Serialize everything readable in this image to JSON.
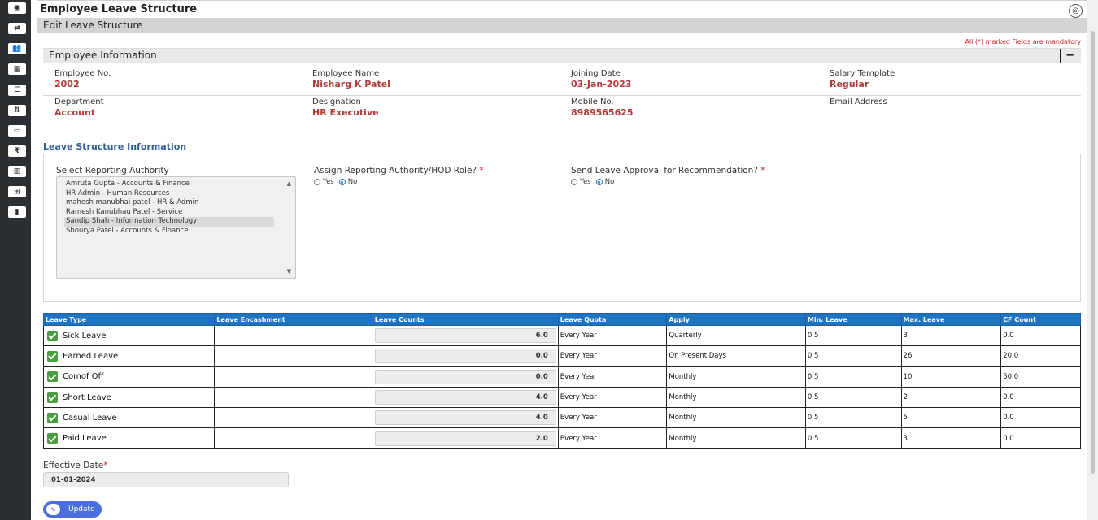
{
  "sidebar": {
    "icons": [
      {
        "name": "dashboard-icon",
        "glyph": "◉"
      },
      {
        "name": "shuffle-icon",
        "glyph": "⇄"
      },
      {
        "name": "users-icon",
        "glyph": "👥"
      },
      {
        "name": "calendar-icon",
        "glyph": "▦"
      },
      {
        "name": "list-icon",
        "glyph": "☰"
      },
      {
        "name": "sort-icon",
        "glyph": "⇅"
      },
      {
        "name": "money-icon",
        "glyph": "▭"
      },
      {
        "name": "rupee-icon",
        "glyph": "₹"
      },
      {
        "name": "chart-icon",
        "glyph": "▥"
      },
      {
        "name": "org-chart-icon",
        "glyph": "⊞"
      },
      {
        "name": "bookmark-icon",
        "glyph": "▮"
      }
    ]
  },
  "header": {
    "title": "Employee Leave Structure",
    "subtitle": "Edit Leave Structure",
    "mandatory_note": "All (*) marked Fields are mandatory"
  },
  "employee_info": {
    "title": "Employee Information",
    "collapse_label": "−",
    "rows": [
      [
        {
          "label": "Employee No.",
          "value": "2002"
        },
        {
          "label": "Employee Name",
          "value": "Nisharg K Patel"
        },
        {
          "label": "Joining Date",
          "value": "03-Jan-2023"
        },
        {
          "label": "Salary Template",
          "value": "Regular"
        }
      ],
      [
        {
          "label": "Department",
          "value": "Account"
        },
        {
          "label": "Designation",
          "value": "HR Executive"
        },
        {
          "label": "Mobile No.",
          "value": "8989565625"
        },
        {
          "label": "Email Address",
          "value": ""
        }
      ]
    ]
  },
  "leave_structure": {
    "title": "Leave Structure Information",
    "reporting_authority_label": "Select Reporting Authority",
    "reporting_authorities": [
      "Amruta Gupta - Accounts & Finance",
      "HR Admin - Human Resources",
      "mahesh manubhai patel - HR & Admin",
      "Ramesh Kanubhau Patel - Service",
      "Sandip Shah - Information Technology",
      "Shourya Patel - Accounts & Finance"
    ],
    "selected_authority_index": 4,
    "assign_hod_label": "Assign Reporting Authority/HOD Role?",
    "send_approval_label": "Send Leave Approval for Recommendation?",
    "required_mark": "*",
    "yes_label": "Yes",
    "no_label": "No",
    "assign_hod_value": "No",
    "send_approval_value": "No"
  },
  "leave_table": {
    "columns": [
      "Leave Type",
      "Leave Encashment",
      "Leave Counts",
      "Leave Quota",
      "Apply",
      "Min. Leave",
      "Max. Leave",
      "CF Count"
    ],
    "rows": [
      {
        "type": "Sick Leave",
        "encashment": "",
        "count": "6.0",
        "quota": "Every Year",
        "apply": "Quarterly",
        "min": "0.5",
        "max": "3",
        "cf": "0.0"
      },
      {
        "type": "Earned Leave",
        "encashment": "",
        "count": "0.0",
        "quota": "Every Year",
        "apply": "On Present Days",
        "min": "0.5",
        "max": "26",
        "cf": "20.0"
      },
      {
        "type": "Comof Off",
        "encashment": "",
        "count": "0.0",
        "quota": "Every Year",
        "apply": "Monthly",
        "min": "0.5",
        "max": "10",
        "cf": "50.0"
      },
      {
        "type": "Short Leave",
        "encashment": "",
        "count": "4.0",
        "quota": "Every Year",
        "apply": "Monthly",
        "min": "0.5",
        "max": "2",
        "cf": "0.0"
      },
      {
        "type": "Casual Leave",
        "encashment": "",
        "count": "4.0",
        "quota": "Every Year",
        "apply": "Monthly",
        "min": "0.5",
        "max": "5",
        "cf": "0.0"
      },
      {
        "type": "Paid Leave",
        "encashment": "",
        "count": "2.0",
        "quota": "Every Year",
        "apply": "Monthly",
        "min": "0.5",
        "max": "3",
        "cf": "0.0"
      }
    ]
  },
  "effective_date": {
    "label": "Effective Date",
    "required_mark": "*",
    "value": "01-01-2024"
  },
  "actions": {
    "update_label": "Update"
  },
  "colors": {
    "accent": "#1f74c2",
    "value_red": "#b03a3a",
    "check_green": "#4a9e3f",
    "button": "#4a6fdc"
  }
}
